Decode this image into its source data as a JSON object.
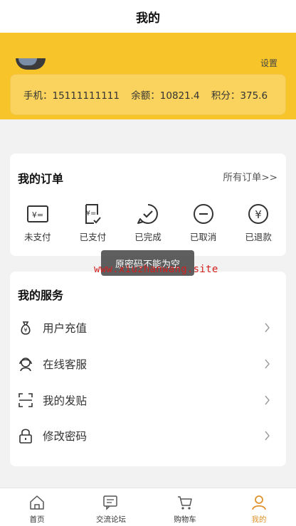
{
  "navbar": {
    "title": "我的"
  },
  "header": {
    "top_right_text": "设置",
    "phone_label": "手机：",
    "phone": "15111111111",
    "balance_label": "余额：",
    "balance": "10821.4",
    "points_label": "积分：",
    "points": "375.6",
    "bg_color": "#f7c52a"
  },
  "orders": {
    "title": "我的订单",
    "all_link": "所有订单>>",
    "items": [
      {
        "label": "未支付",
        "icon": "unpaid-icon"
      },
      {
        "label": "已支付",
        "icon": "paid-icon"
      },
      {
        "label": "已完成",
        "icon": "completed-icon"
      },
      {
        "label": "已取消",
        "icon": "cancelled-icon"
      },
      {
        "label": "已退款",
        "icon": "refund-icon"
      }
    ]
  },
  "toast": {
    "text": "原密码不能为空"
  },
  "watermark": {
    "text": "www.xiuzhanwang.site",
    "color": "#d32020"
  },
  "services": {
    "title": "我的服务",
    "items": [
      {
        "label": "用户充值",
        "icon": "money-bag-icon"
      },
      {
        "label": "在线客服",
        "icon": "customer-service-icon"
      },
      {
        "label": "我的发贴",
        "icon": "scan-icon"
      },
      {
        "label": "修改密码",
        "icon": "lock-icon"
      }
    ]
  },
  "tabbar": {
    "active_color": "#e0922b",
    "items": [
      {
        "label": "首页",
        "icon": "home-icon"
      },
      {
        "label": "交流论坛",
        "icon": "forum-icon"
      },
      {
        "label": "购物车",
        "icon": "cart-icon"
      },
      {
        "label": "我的",
        "icon": "user-icon"
      }
    ]
  }
}
